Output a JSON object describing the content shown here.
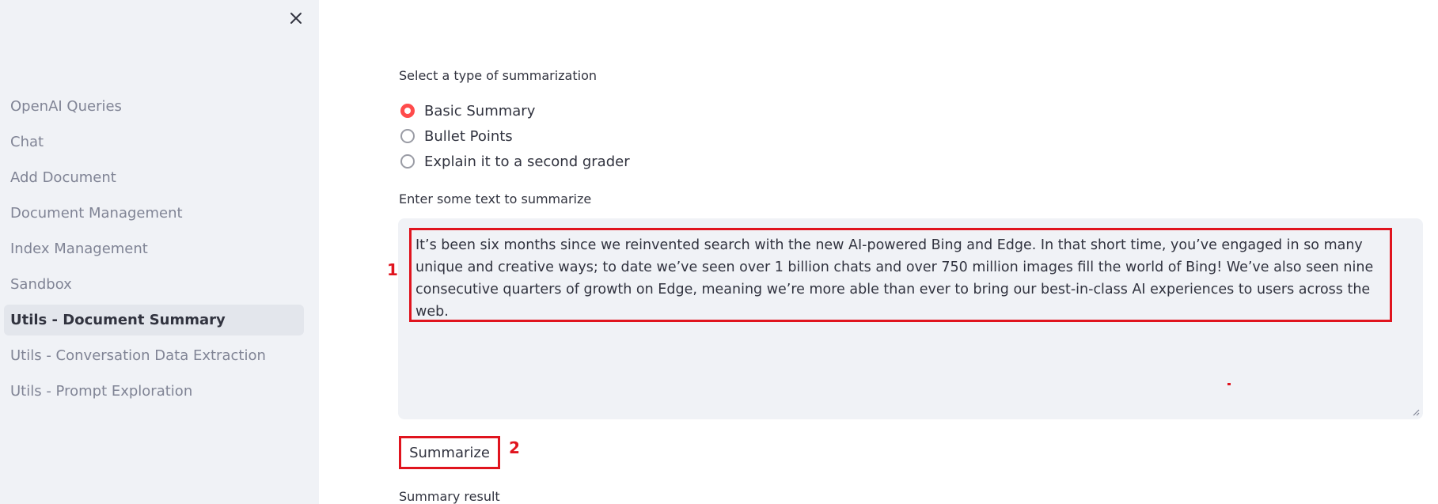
{
  "sidebar": {
    "close_icon": "close-icon",
    "items": [
      {
        "label": "OpenAI Queries",
        "active": false
      },
      {
        "label": "Chat",
        "active": false
      },
      {
        "label": "Add Document",
        "active": false
      },
      {
        "label": "Document Management",
        "active": false
      },
      {
        "label": "Index Management",
        "active": false
      },
      {
        "label": "Sandbox",
        "active": false
      },
      {
        "label": "Utils - Document Summary",
        "active": true
      },
      {
        "label": "Utils - Conversation Data Extraction",
        "active": false
      },
      {
        "label": "Utils - Prompt Exploration",
        "active": false
      }
    ]
  },
  "main": {
    "summarization_label": "Select a type of summarization",
    "options": [
      {
        "label": "Basic Summary",
        "checked": true
      },
      {
        "label": "Bullet Points",
        "checked": false
      },
      {
        "label": "Explain it to a second grader",
        "checked": false
      }
    ],
    "text_label": "Enter some text to summarize",
    "text_value": "It’s been six months since we reinvented search with the new AI-powered Bing and Edge. In that short time, you’ve engaged in so many unique and creative ways; to date we’ve seen over 1 billion chats and over 750 million images fill the world of Bing! We’ve also seen nine consecutive quarters of growth on Edge, meaning we’re more able than ever to bring our best-in-class AI experiences to users across the web.",
    "summarize_label": "Summarize",
    "result_label": "Summary result"
  },
  "annotations": {
    "marker_1": "1",
    "marker_2": "2",
    "color": "#e0141e"
  },
  "colors": {
    "sidebar_bg": "#f0f2f6",
    "accent": "#ff4b4b",
    "text": "#31333f",
    "muted": "#808495"
  }
}
